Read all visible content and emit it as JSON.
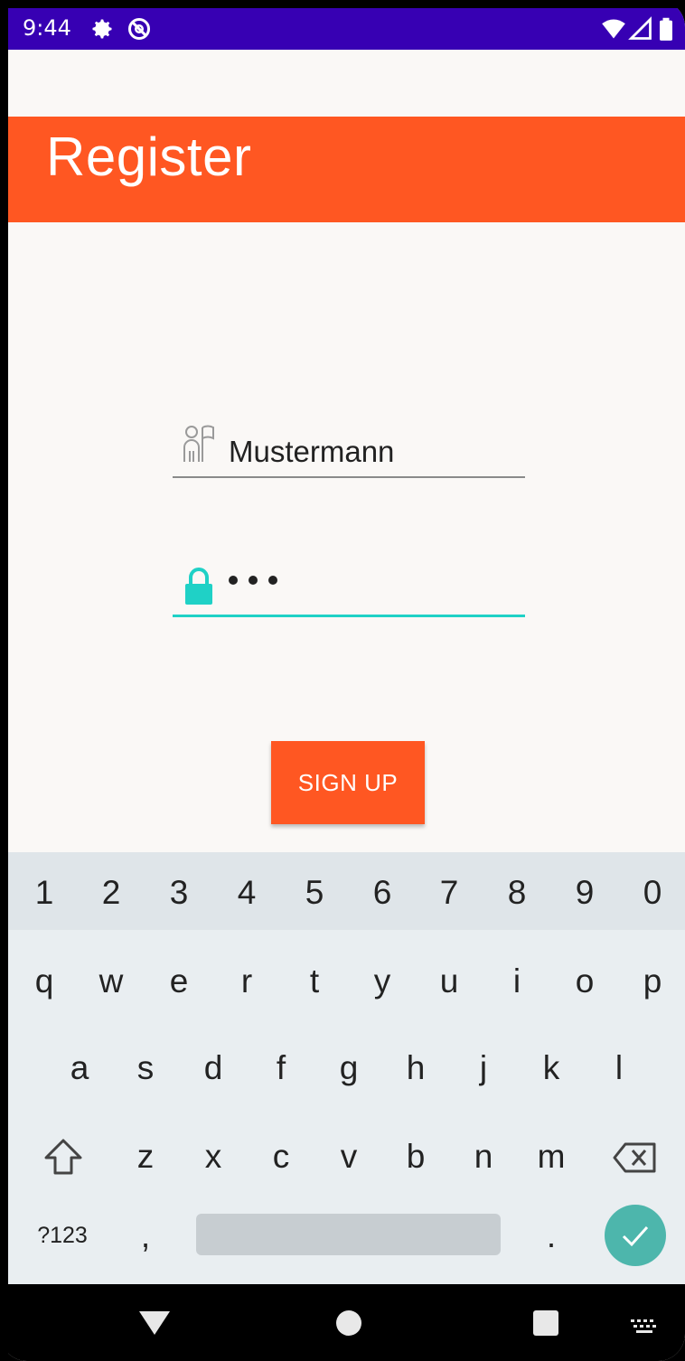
{
  "status_bar": {
    "time": "9:44",
    "icons": [
      "gear-icon",
      "do-not-disturb-icon",
      "wifi-icon",
      "signal-icon",
      "battery-icon"
    ]
  },
  "app_bar": {
    "title": "Register"
  },
  "form": {
    "username": {
      "value": "Mustermann",
      "icon": "user-flag-icon"
    },
    "password": {
      "masked_length": 3,
      "icon": "lock-icon"
    },
    "signup_label": "SIGN UP"
  },
  "colors": {
    "accent": "#ff5722",
    "primary_dark": "#3700b3",
    "teal": "#1fd1c6",
    "enter": "#4db6ac"
  },
  "keyboard": {
    "numbers": [
      "1",
      "2",
      "3",
      "4",
      "5",
      "6",
      "7",
      "8",
      "9",
      "0"
    ],
    "row1": [
      "q",
      "w",
      "e",
      "r",
      "t",
      "y",
      "u",
      "i",
      "o",
      "p"
    ],
    "row2": [
      "a",
      "s",
      "d",
      "f",
      "g",
      "h",
      "j",
      "k",
      "l"
    ],
    "row3": [
      "z",
      "x",
      "c",
      "v",
      "b",
      "n",
      "m"
    ],
    "symbols_label": "?123",
    "comma": ",",
    "period": "."
  }
}
